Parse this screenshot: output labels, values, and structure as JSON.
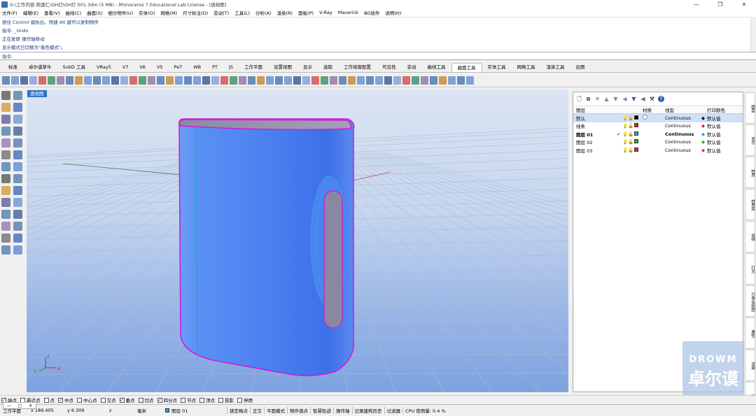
{
  "title_bar": {
    "title": "G:\\工作内容-陈国仁\\GH灯\\GH灯 001.3dm (5 MB) - Rhinoceros 7 Educational Lab License - [透视图]",
    "minimize": "—",
    "maximize": "❐",
    "close": "✕"
  },
  "menu": [
    "文件(F)",
    "编辑(E)",
    "查看(V)",
    "曲线(C)",
    "曲面(S)",
    "细分物件(U)",
    "实体(O)",
    "网格(M)",
    "尺寸标注(D)",
    "变动(T)",
    "工具(L)",
    "分析(A)",
    "渲染(R)",
    "面板(P)",
    "V-Ray",
    "Maverick",
    "BG插件",
    "说明(H)"
  ],
  "command_history": [
    "按住 Control 键执出，快捷 Alt 键可以复制物件",
    "指令: _Undo",
    "正在复原 操作轴移动",
    "显示模式已切换为\"着色模式\"。"
  ],
  "command_prompt": "指令:",
  "tabs": [
    "标准",
    "卓尔谟草牛",
    "SubD 工具",
    "VRay5",
    "V7",
    "V6",
    "V5",
    "PeT",
    "WB",
    "PT",
    "JS",
    "工作平面",
    "设置视图",
    "显示",
    "选取",
    "工作视窗配置",
    "可见性",
    "变动",
    "曲线工具",
    "曲面工具",
    "实体工具",
    "网格工具",
    "渲染工具",
    "出图"
  ],
  "active_tab": "曲面工具",
  "viewport": {
    "label": "透视图"
  },
  "axis": {
    "x": "x",
    "y": "y",
    "z": "z"
  },
  "layer_panel": {
    "headers": {
      "name": "图层",
      "material": "材质",
      "linetype": "线型",
      "print_color": "打印颜色"
    },
    "layers": [
      {
        "name": "默认",
        "current": "",
        "linetype": "Continuous",
        "print": "默认值",
        "color": "#000000",
        "print_color": "#000000",
        "bold": false,
        "selected": true
      },
      {
        "name": "线条",
        "current": "",
        "linetype": "Continuous",
        "print": "默认值",
        "color": "#e02020",
        "print_color": "#e02020",
        "bold": false,
        "selected": false
      },
      {
        "name": "图层 01",
        "current": "✓",
        "linetype": "Continuous",
        "print": "默认值",
        "color": "#2aa0e0",
        "print_color": "#2aa0e0",
        "bold": true,
        "selected": false
      },
      {
        "name": "图层 02",
        "current": "",
        "linetype": "Continuous",
        "print": "默认值",
        "color": "#20b020",
        "print_color": "#20b020",
        "bold": false,
        "selected": false
      },
      {
        "name": "图层 03",
        "current": "",
        "linetype": "Continuous",
        "print": "默认值",
        "color": "#e0207a",
        "print_color": "#e0207a",
        "bold": false,
        "selected": false
      }
    ]
  },
  "right_dock": [
    "图层",
    "显示",
    "材质",
    "材质库",
    "说明",
    "灯光",
    "已命名视图",
    "属性",
    "渲染",
    "环境"
  ],
  "logo": {
    "top": "DROWM",
    "bottom": "卓尔谟"
  },
  "osnaps": [
    {
      "label": "端点",
      "checked": true
    },
    {
      "label": "最近点",
      "checked": false
    },
    {
      "label": "点",
      "checked": false
    },
    {
      "label": "中点",
      "checked": true
    },
    {
      "label": "中心点",
      "checked": false
    },
    {
      "label": "交点",
      "checked": false
    },
    {
      "label": "垂点",
      "checked": true
    },
    {
      "label": "切点",
      "checked": false
    },
    {
      "label": "四分点",
      "checked": true
    },
    {
      "label": "节点",
      "checked": false
    },
    {
      "label": "顶点",
      "checked": false
    },
    {
      "label": "投影",
      "checked": false
    },
    {
      "label": "停用",
      "checked": false
    }
  ],
  "status": {
    "cplane": "工作平面",
    "x": "x 189.405",
    "y": "y 6.309",
    "z": "z",
    "units": "毫米",
    "layer": "图层 01",
    "buttons": [
      "锁定格点",
      "正交",
      "平面模式",
      "物件锁点",
      "智慧轨迹",
      "操作轴",
      "记录建构历史",
      "过滤器"
    ],
    "cpu": "CPU 使用量: 0.4 %"
  },
  "colors": {
    "object": "#4f86f0",
    "edge": "#d21cd6",
    "viewport_tab": "#2f74c9",
    "layer_selected": "#cfe0f7"
  }
}
